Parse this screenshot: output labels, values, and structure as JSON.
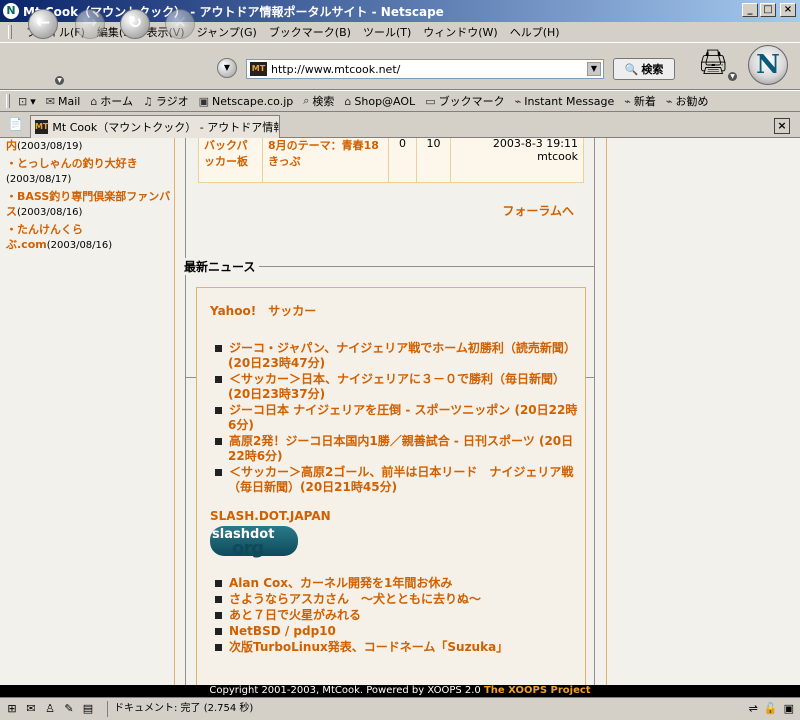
{
  "window": {
    "title": "Mt Cook（マウントクック） - アウトドア情報ポータルサイト - Netscape",
    "app_icon": "N"
  },
  "menu": [
    "ファイル(F)",
    "編集(E)",
    "表示(V)",
    "ジャンプ(G)",
    "ブックマーク(B)",
    "ツール(T)",
    "ウィンドウ(W)",
    "ヘルプ(H)"
  ],
  "nav": {
    "url": "http://www.mtcook.net/",
    "search_label": "検索",
    "logo": "N"
  },
  "personal_toolbar": [
    "Mail",
    "ホーム",
    "ラジオ",
    "Netscape.co.jp",
    "検索",
    "Shop@AOL",
    "ブックマーク",
    "Instant Message",
    "新着",
    "お勧め"
  ],
  "tab": {
    "title": "Mt Cook（マウントクック） - アウトドア情報ポ..."
  },
  "sidebar": {
    "items": [
      {
        "title": "内",
        "date": "(2003/08/19)"
      },
      {
        "title": "・とっしゃんの釣り大好き",
        "date": "(2003/08/17)"
      },
      {
        "title": "・BASS釣り専門倶楽部ファンバス",
        "date": "(2003/08/16)"
      },
      {
        "title": "・たんけんくらぶ.com",
        "date": "(2003/08/16)"
      }
    ]
  },
  "forum": {
    "row": {
      "name": "バックパッカー板",
      "topic": "8月のテーマ：青春18きっぷ",
      "topics": "0",
      "posts": "10",
      "last_date": "2003-8-3 19:11",
      "last_user": "mtcook"
    },
    "link": "フォーラムへ"
  },
  "news": {
    "heading": "最新ニュース",
    "sources": [
      {
        "name": "Yahoo!　サッカー",
        "items": [
          "ジーコ・ジャパン、ナイジェリア戦でホーム初勝利（読売新聞）(20日23時47分)",
          "＜サッカー＞日本、ナイジェリアに３－０で勝利（毎日新聞）(20日23時37分)",
          "ジーコ日本 ナイジェリアを圧倒 - スポーツニッポン (20日22時6分)",
          "高原2発！ジーコ日本国内1勝／親善試合 - 日刊スポーツ (20日22時6分)",
          "＜サッカー＞高原2ゴール、前半は日本リード　ナイジェリア戦（毎日新聞）(20日21時45分)"
        ]
      },
      {
        "name": "SLASH.DOT.JAPAN",
        "logo_text": "slashdot",
        "logo_sub": "org",
        "items": [
          "Alan Cox、カーネル開発を1年間お休み",
          "さようならアスカさん　～犬とともに去りぬ～",
          "あと７日で火星がみれる",
          "NetBSD / pdp10",
          "次版TurboLinux発表、コードネーム「Suzuka」"
        ]
      }
    ]
  },
  "footer": {
    "copyright": "Copyright 2001-2003, MtCook. Powered by XOOPS 2.0 ",
    "xoops": "The XOOPS Project"
  },
  "status": {
    "text": "ドキュメント: 完了 (2.754 秒)"
  }
}
